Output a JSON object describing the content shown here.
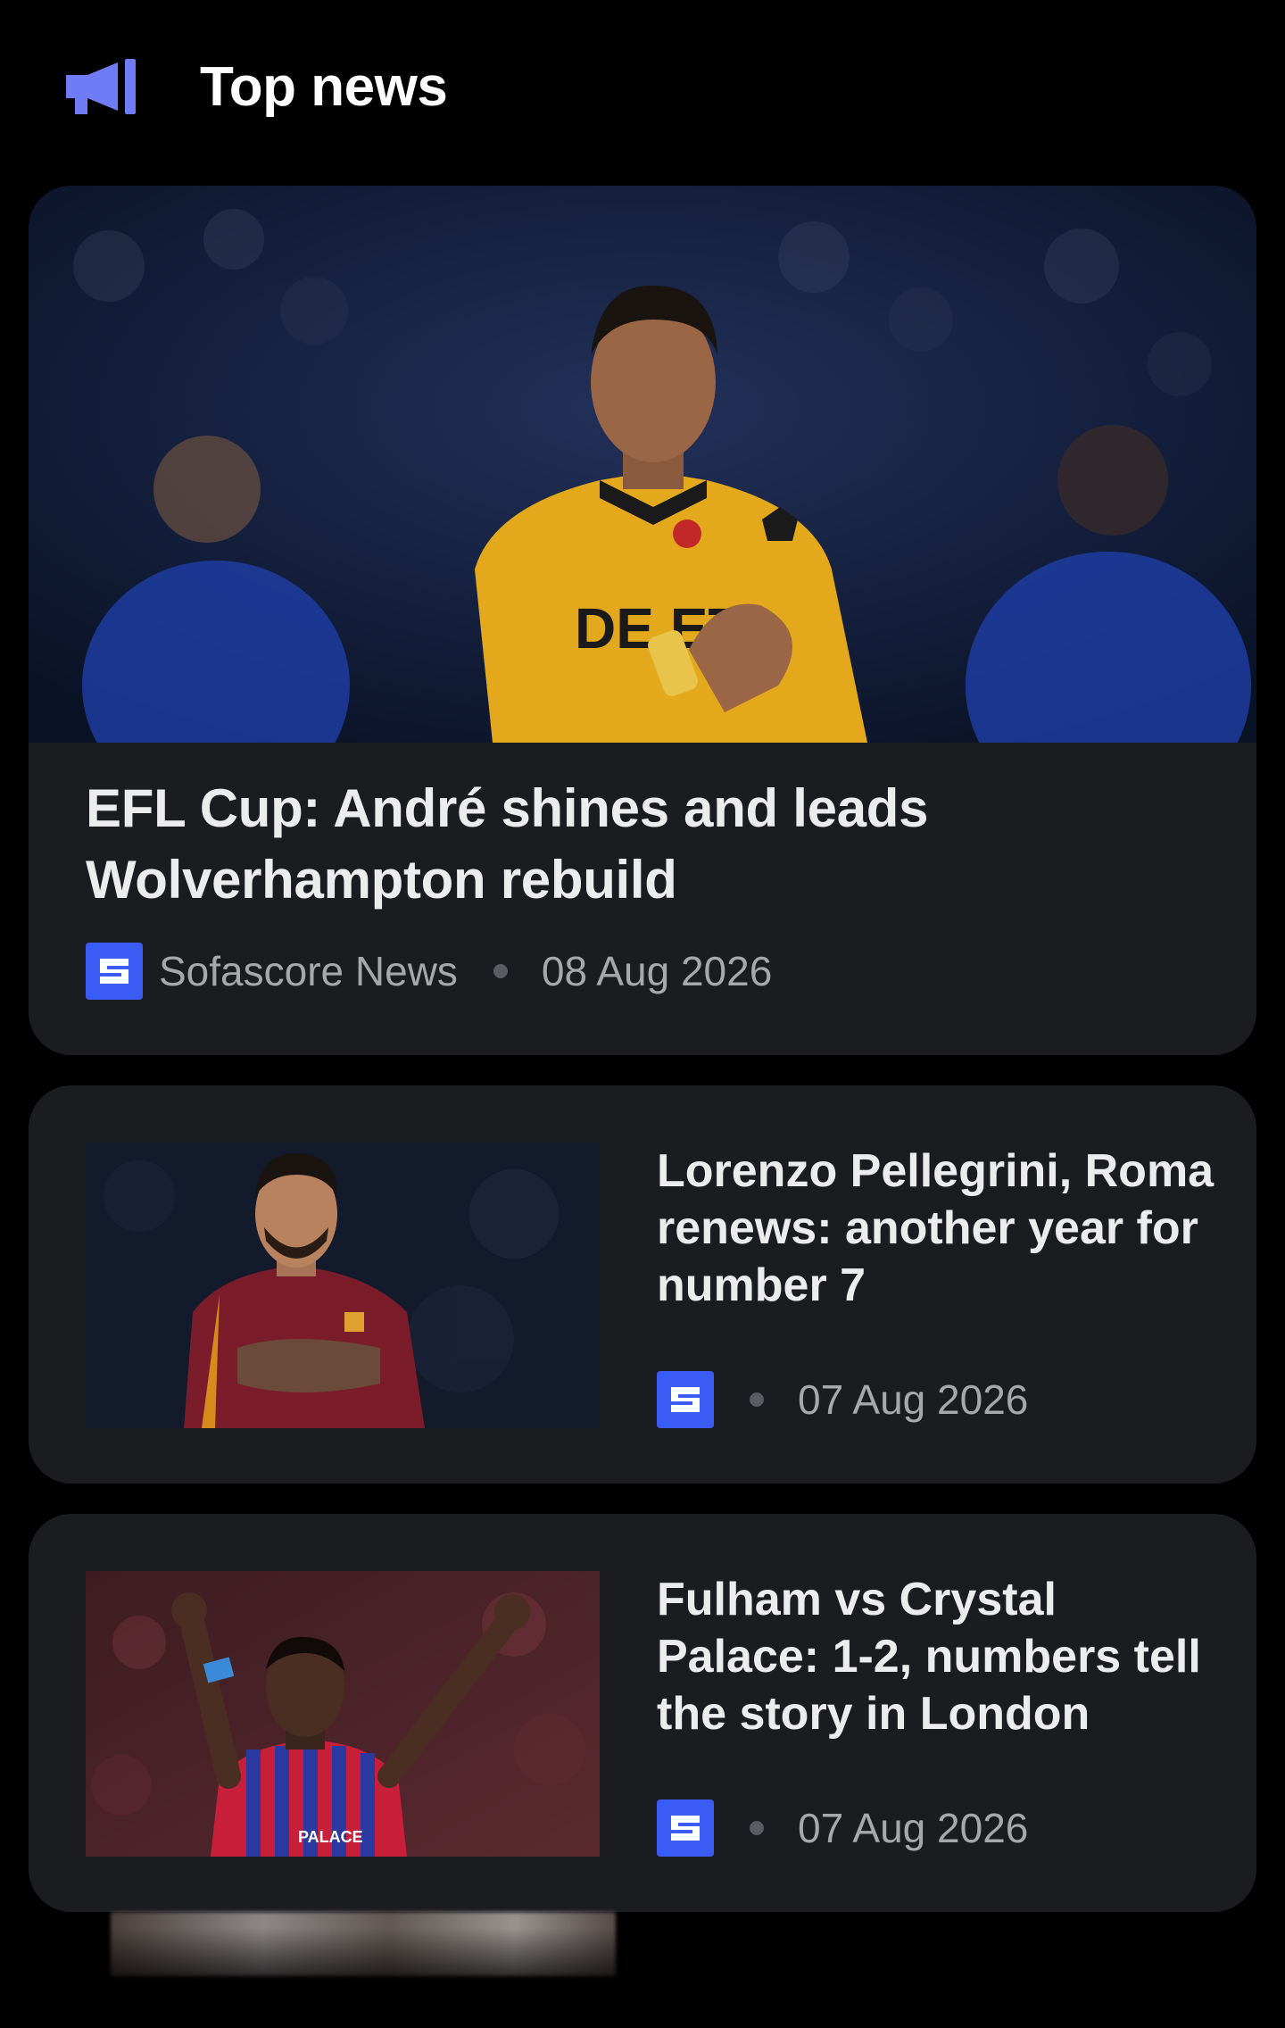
{
  "header": {
    "title": "Top news",
    "icon": "megaphone-icon",
    "accent": "#6f7cf6"
  },
  "news": [
    {
      "title": "EFL Cup: André shines and leads Wolverhampton rebuild",
      "source": "Sofascore News",
      "date": "08 Aug 2026",
      "image": "player in gold Wolverhampton shirt applauding"
    },
    {
      "title": "Lorenzo Pellegrini, Roma renews: another year for number 7",
      "source": "",
      "date": "07 Aug 2026",
      "image": "player in maroon Roma shirt"
    },
    {
      "title": "Fulham vs Crystal Palace: 1-2, numbers tell the story in London",
      "source": "",
      "date": "07 Aug 2026",
      "image": "player in red and blue striped Crystal Palace shirt raising arms"
    }
  ],
  "colors": {
    "background": "#000000",
    "card": "#1a1c1f",
    "brand_logo": "#3c5cf6",
    "text_secondary": "#a6a8ac"
  }
}
